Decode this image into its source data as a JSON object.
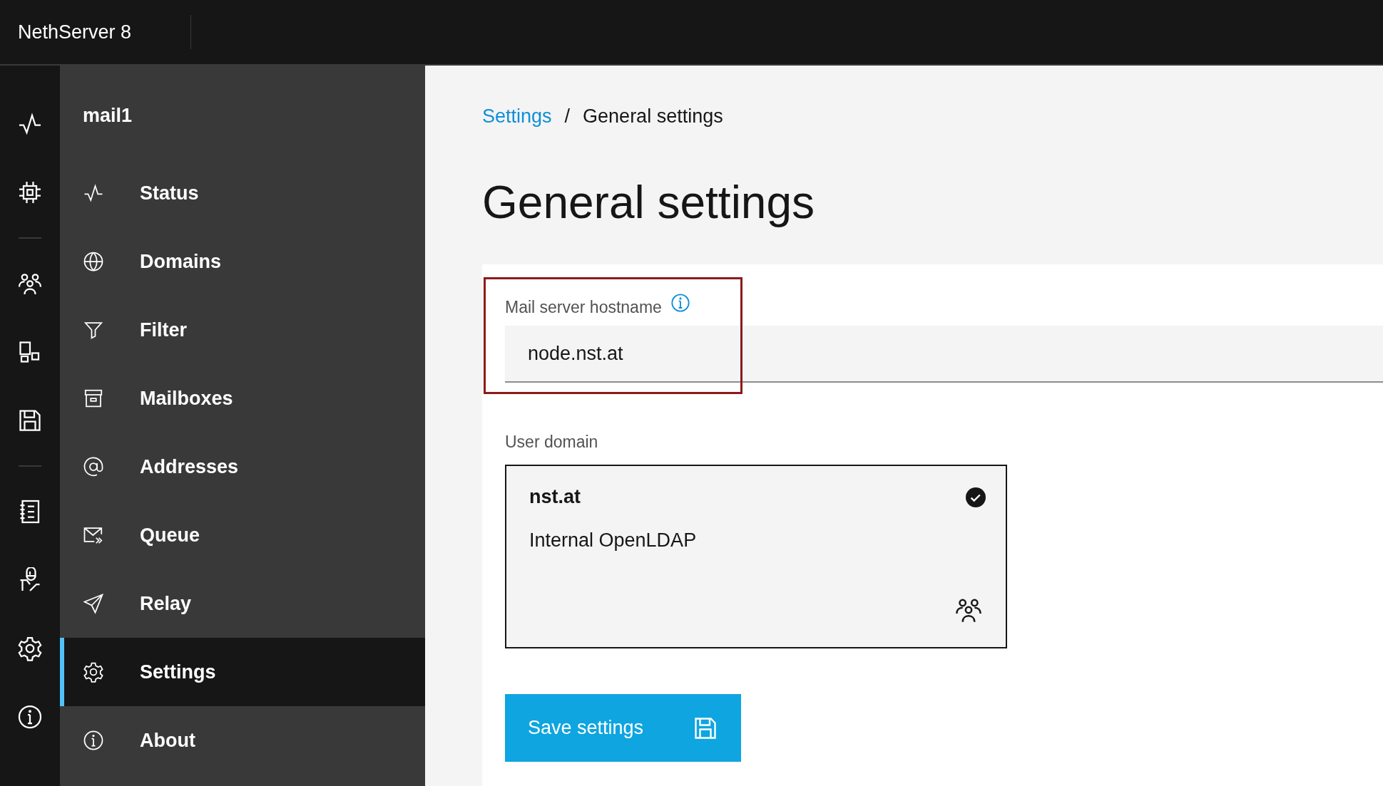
{
  "header": {
    "title": "NethServer 8"
  },
  "sidebar": {
    "title": "mail1",
    "items": [
      {
        "label": "Status",
        "selected": false
      },
      {
        "label": "Domains",
        "selected": false
      },
      {
        "label": "Filter",
        "selected": false
      },
      {
        "label": "Mailboxes",
        "selected": false
      },
      {
        "label": "Addresses",
        "selected": false
      },
      {
        "label": "Queue",
        "selected": false
      },
      {
        "label": "Relay",
        "selected": false
      },
      {
        "label": "Settings",
        "selected": true
      },
      {
        "label": "About",
        "selected": false
      }
    ]
  },
  "breadcrumb": [
    {
      "label": "Settings",
      "link": true
    },
    {
      "label": "General settings",
      "link": false
    }
  ],
  "separator": "/",
  "page_title": "General settings",
  "hostname_field": {
    "label": "Mail server hostname",
    "value": "node.nst.at",
    "highlighted": true
  },
  "user_domain": {
    "label": "User domain",
    "tile": {
      "name": "nst.at",
      "description": "Internal OpenLDAP",
      "selected": true
    }
  },
  "save_button": {
    "label": "Save settings"
  }
}
